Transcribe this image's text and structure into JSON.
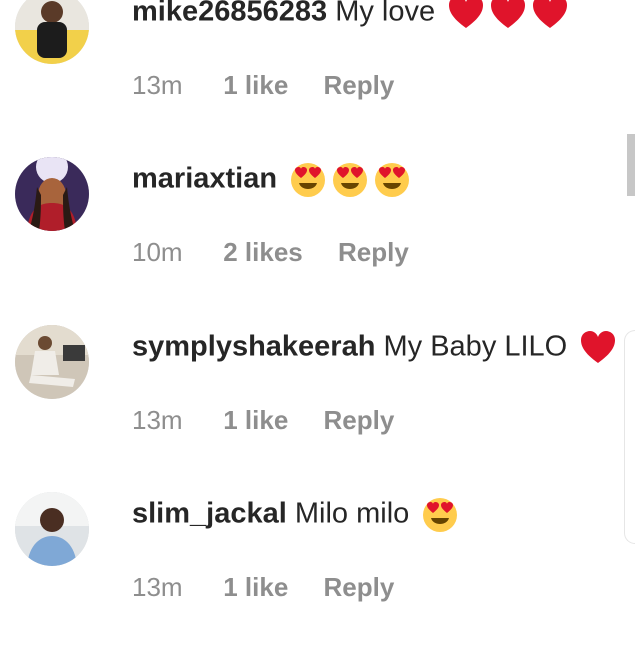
{
  "comments": [
    {
      "username": "mike26856283",
      "text": "My love",
      "emojis": [
        "red-heart",
        "red-heart",
        "red-heart"
      ],
      "time": "13m",
      "likes": "1 like",
      "reply": "Reply"
    },
    {
      "username": "mariaxtian",
      "text": "",
      "emojis": [
        "heart-eyes",
        "heart-eyes",
        "heart-eyes"
      ],
      "time": "10m",
      "likes": "2 likes",
      "reply": "Reply"
    },
    {
      "username": "symplyshakeerah",
      "text": "My Baby LILO",
      "emojis": [
        "red-heart"
      ],
      "time": "13m",
      "likes": "1 like",
      "reply": "Reply"
    },
    {
      "username": "slim_jackal",
      "text": "Milo milo",
      "emojis": [
        "heart-eyes"
      ],
      "time": "13m",
      "likes": "1 like",
      "reply": "Reply"
    }
  ],
  "colors": {
    "username": "#262626",
    "meta": "#8e8e8e",
    "heart": "#e0142b",
    "emoji_face": "#ffcc4d"
  }
}
